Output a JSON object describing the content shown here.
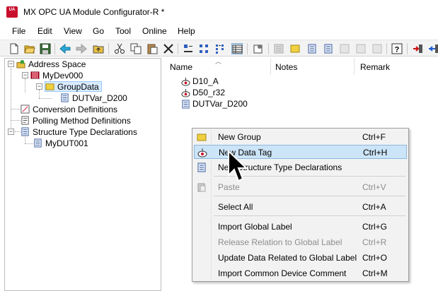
{
  "window": {
    "title": "MX OPC UA Module Configurator-R *",
    "icon_text": "UA",
    "accent": "#c8102e"
  },
  "menu": [
    "File",
    "Edit",
    "View",
    "Go",
    "Tool",
    "Online",
    "Help"
  ],
  "toolbar_icons": [
    "new-icon",
    "open-icon",
    "save-icon",
    "back-icon",
    "forward-icon",
    "up-folder-icon",
    "cut-icon",
    "copy-icon",
    "paste-icon",
    "delete-icon",
    "large-icons-view-icon",
    "small-icons-view-icon",
    "list-view-icon",
    "details-view-icon",
    "properties-icon",
    "data-tag-icon",
    "new-group-icon",
    "structure-icon",
    "struct-type-icon",
    "disabled-icon-1",
    "disabled-icon-2",
    "disabled-icon-3",
    "help-icon",
    "import-icon",
    "export-icon"
  ],
  "tree": {
    "root": "Address Space",
    "device": "MyDev000",
    "group": "GroupData",
    "group_child": "DUTVar_D200",
    "conversion": "Conversion Definitions",
    "polling": "Polling Method Definitions",
    "struct_types": "Structure Type Declarations",
    "struct_child": "MyDUT001"
  },
  "list": {
    "columns": [
      "Name",
      "Notes",
      "Remark"
    ],
    "rows": [
      "D10_A",
      "D50_r32",
      "DUTVar_D200"
    ]
  },
  "context_menu": {
    "items": [
      {
        "label": "New Group",
        "accel": "Ctrl+F",
        "icon": "folder-icon",
        "disabled": false
      },
      {
        "label": "New Data Tag",
        "accel": "Ctrl+H",
        "icon": "data-tag-icon",
        "disabled": false,
        "hover": true
      },
      {
        "label": "New Structure Type Declarations",
        "accel": "",
        "icon": "structure-icon",
        "disabled": false
      },
      {
        "label": "Paste",
        "accel": "Ctrl+V",
        "icon": "paste-icon",
        "disabled": true
      },
      {
        "label": "Select All",
        "accel": "Ctrl+A",
        "icon": "",
        "disabled": false
      },
      {
        "label": "Import Global Label",
        "accel": "Ctrl+G",
        "icon": "",
        "disabled": false
      },
      {
        "label": "Release Relation to Global Label",
        "accel": "Ctrl+R",
        "icon": "",
        "disabled": true
      },
      {
        "label": "Update Data Related to Global Label",
        "accel": "Ctrl+O",
        "icon": "",
        "disabled": false
      },
      {
        "label": "Import Common Device Comment",
        "accel": "Ctrl+M",
        "icon": "",
        "disabled": false
      }
    ]
  }
}
